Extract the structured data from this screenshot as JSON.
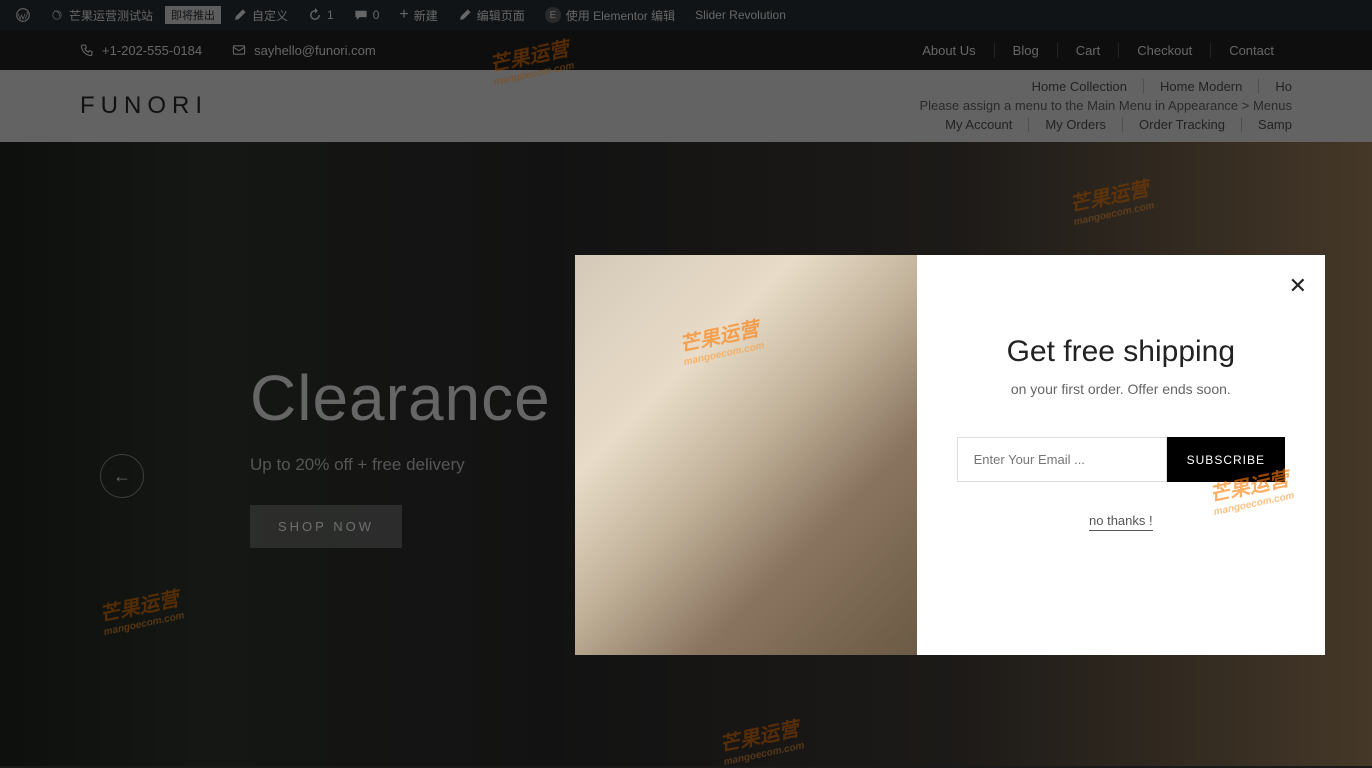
{
  "adminBar": {
    "site": "芒果运营测试站",
    "badge": "即将推出",
    "customize": "自定义",
    "updates": "1",
    "comments": "0",
    "new": "新建",
    "editPage": "编辑页面",
    "elementor": "使用 Elementor 编辑",
    "slider": "Slider Revolution"
  },
  "topbar": {
    "phone": "+1-202-555-0184",
    "email": "sayhello@funori.com",
    "links": [
      "About Us",
      "Blog",
      "Cart",
      "Checkout",
      "Contact"
    ]
  },
  "header": {
    "logo": "FUNORI",
    "menuTop": [
      "Home Collection",
      "Home Modern",
      "Ho"
    ],
    "msg": "Please assign a menu to the Main Menu in Appearance > Menus",
    "menuBottom": [
      "My Account",
      "My Orders",
      "Order Tracking",
      "Samp"
    ]
  },
  "hero": {
    "title": "Clearance",
    "sub": "Up to 20% off + free delivery",
    "btn": "SHOP NOW"
  },
  "modal": {
    "title": "Get free shipping",
    "sub": "on your first order. Offer ends soon.",
    "placeholder": "Enter Your Email ...",
    "subscribe": "SUBSCRIBE",
    "noThanks": "no thanks !"
  },
  "watermark": {
    "text": "芒果运营",
    "url": "mangoecom.com"
  }
}
